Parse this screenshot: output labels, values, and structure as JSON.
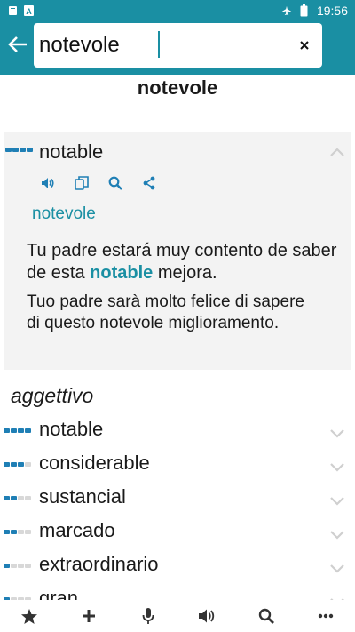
{
  "status": {
    "time": "19:56"
  },
  "search": {
    "value": "notevole"
  },
  "headword": "notevole",
  "card": {
    "word": "notable",
    "translation": "notevole",
    "example_es_before": "Tu padre estará muy contento de saber de esta ",
    "example_es_highlight": "notable",
    "example_es_after": " mejora.",
    "example_it": "Tuo padre sarà molto felice di sapere di questo notevole miglioramento."
  },
  "pos": "aggettivo",
  "entries": [
    {
      "word": "notable",
      "level": 4
    },
    {
      "word": "considerable",
      "level": 3
    },
    {
      "word": "sustancial",
      "level": 2
    },
    {
      "word": "marcado",
      "level": 2
    },
    {
      "word": "extraordinario",
      "level": 1
    },
    {
      "word": "gran",
      "level": 1
    }
  ],
  "icons": {
    "status_left": [
      "book-icon",
      "text-a-icon"
    ],
    "status_right": [
      "airplane-icon",
      "battery-icon"
    ],
    "actions": [
      "speaker-icon",
      "copy-icon",
      "search-icon",
      "share-icon"
    ],
    "bottom": [
      "star-icon",
      "plus-icon",
      "microphone-icon",
      "speaker-icon",
      "search-icon",
      "more-icon"
    ]
  },
  "colors": {
    "accent": "#1a8fa3",
    "freq": "#1f7fb5"
  }
}
